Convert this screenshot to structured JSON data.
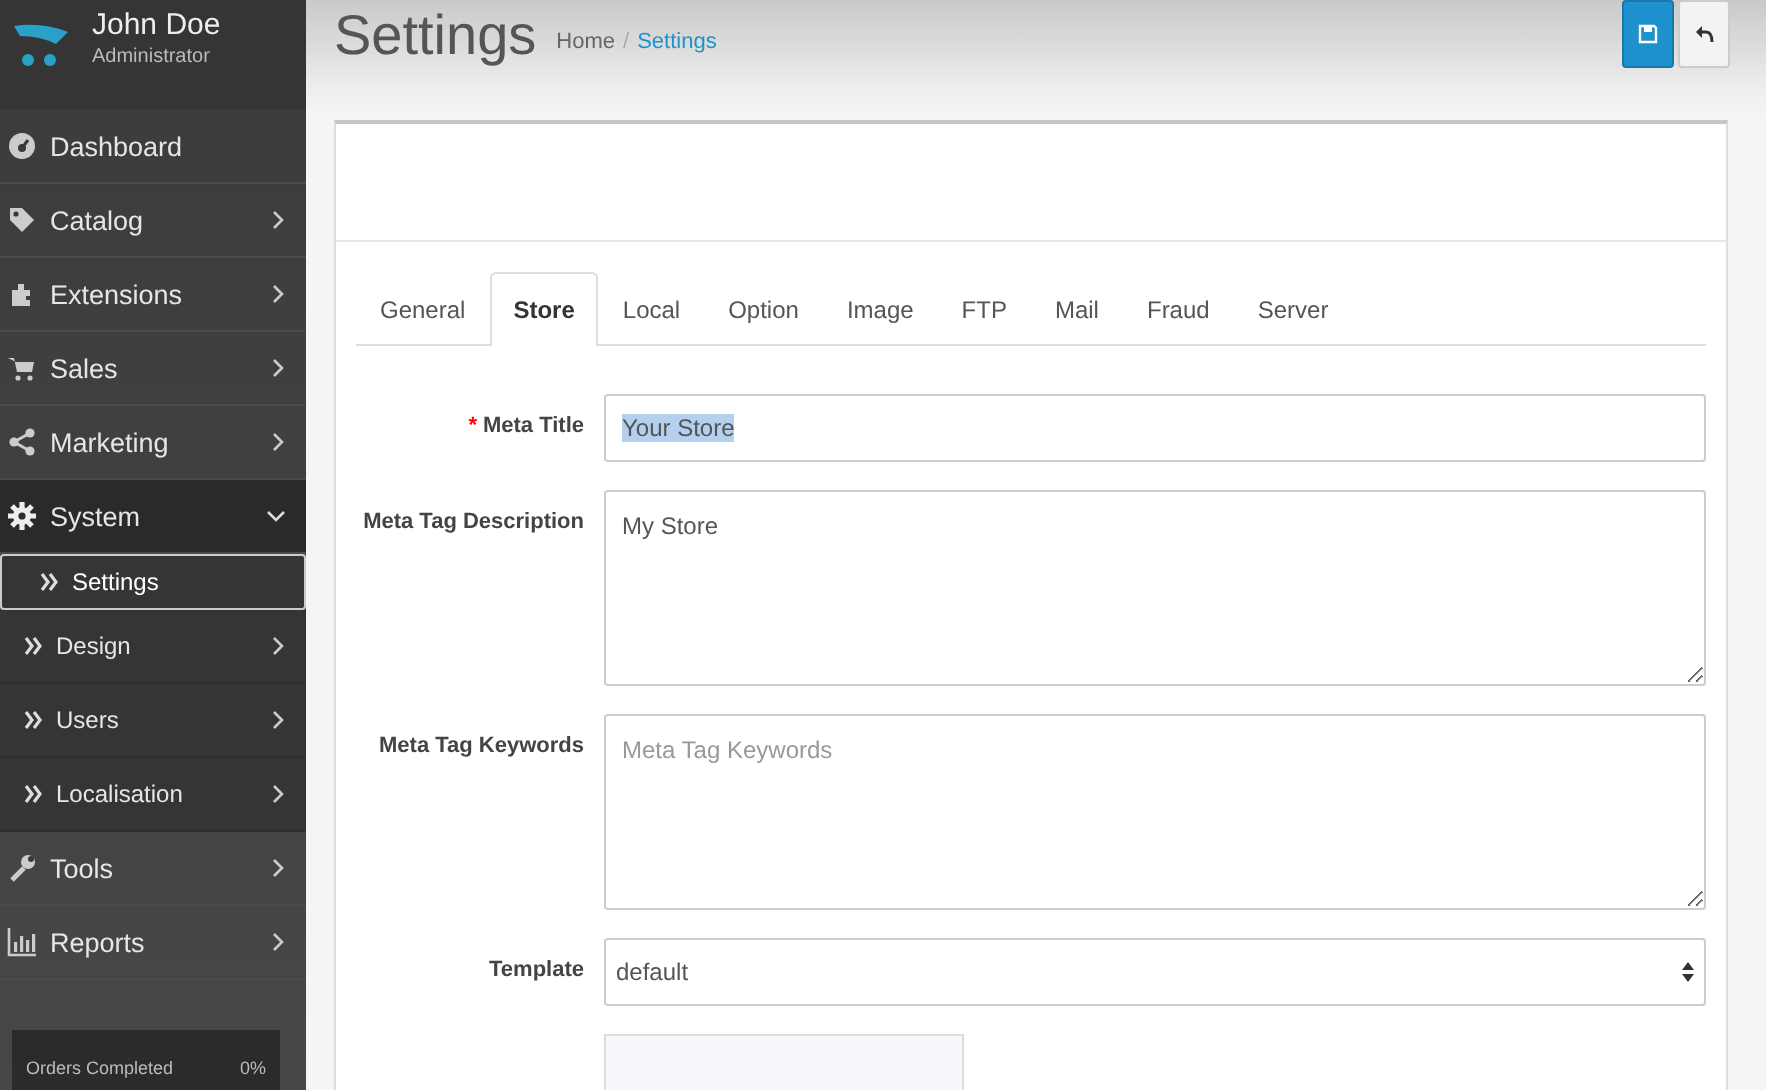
{
  "user": {
    "name": "John Doe",
    "role": "Administrator"
  },
  "menu": [
    {
      "label": "Dashboard",
      "arrow": false,
      "expanded": false
    },
    {
      "label": "Catalog",
      "arrow": true,
      "expanded": false
    },
    {
      "label": "Extensions",
      "arrow": true,
      "expanded": false
    },
    {
      "label": "Sales",
      "arrow": true,
      "expanded": false
    },
    {
      "label": "Marketing",
      "arrow": true,
      "expanded": false
    },
    {
      "label": "System",
      "arrow": true,
      "expanded": true,
      "children": [
        {
          "label": "Settings",
          "arrow": false,
          "selected": true
        },
        {
          "label": "Design",
          "arrow": true,
          "selected": false
        },
        {
          "label": "Users",
          "arrow": true,
          "selected": false
        },
        {
          "label": "Localisation",
          "arrow": true,
          "selected": false
        }
      ]
    },
    {
      "label": "Tools",
      "arrow": true,
      "expanded": false
    },
    {
      "label": "Reports",
      "arrow": true,
      "expanded": false
    }
  ],
  "stats": [
    {
      "label": "Orders Completed",
      "value": "0%"
    }
  ],
  "page": {
    "title": "Settings",
    "separator": "/",
    "breadcrumb": [
      {
        "label": "Home",
        "current": false
      },
      {
        "label": "Settings",
        "current": true
      }
    ]
  },
  "actions": [
    {
      "kind": "save"
    },
    {
      "kind": "back"
    }
  ],
  "tabs": [
    {
      "label": "General",
      "selected": false
    },
    {
      "label": "Store",
      "selected": true
    },
    {
      "label": "Local",
      "selected": false
    },
    {
      "label": "Option",
      "selected": false
    },
    {
      "label": "Image",
      "selected": false
    },
    {
      "label": "FTP",
      "selected": false
    },
    {
      "label": "Mail",
      "selected": false
    },
    {
      "label": "Fraud",
      "selected": false
    },
    {
      "label": "Server",
      "selected": false
    }
  ],
  "form": [
    {
      "kind": "input",
      "label": "Meta Title",
      "required_mark": "*",
      "value": "Your Store",
      "highlighted": true
    },
    {
      "kind": "textarea",
      "label": "Meta Tag Description",
      "value": "My Store"
    },
    {
      "kind": "textarea",
      "label": "Meta Tag Keywords",
      "placeholder": "Meta Tag Keywords"
    },
    {
      "kind": "select",
      "label": "Template",
      "value": "default"
    },
    {
      "kind": "image"
    }
  ]
}
